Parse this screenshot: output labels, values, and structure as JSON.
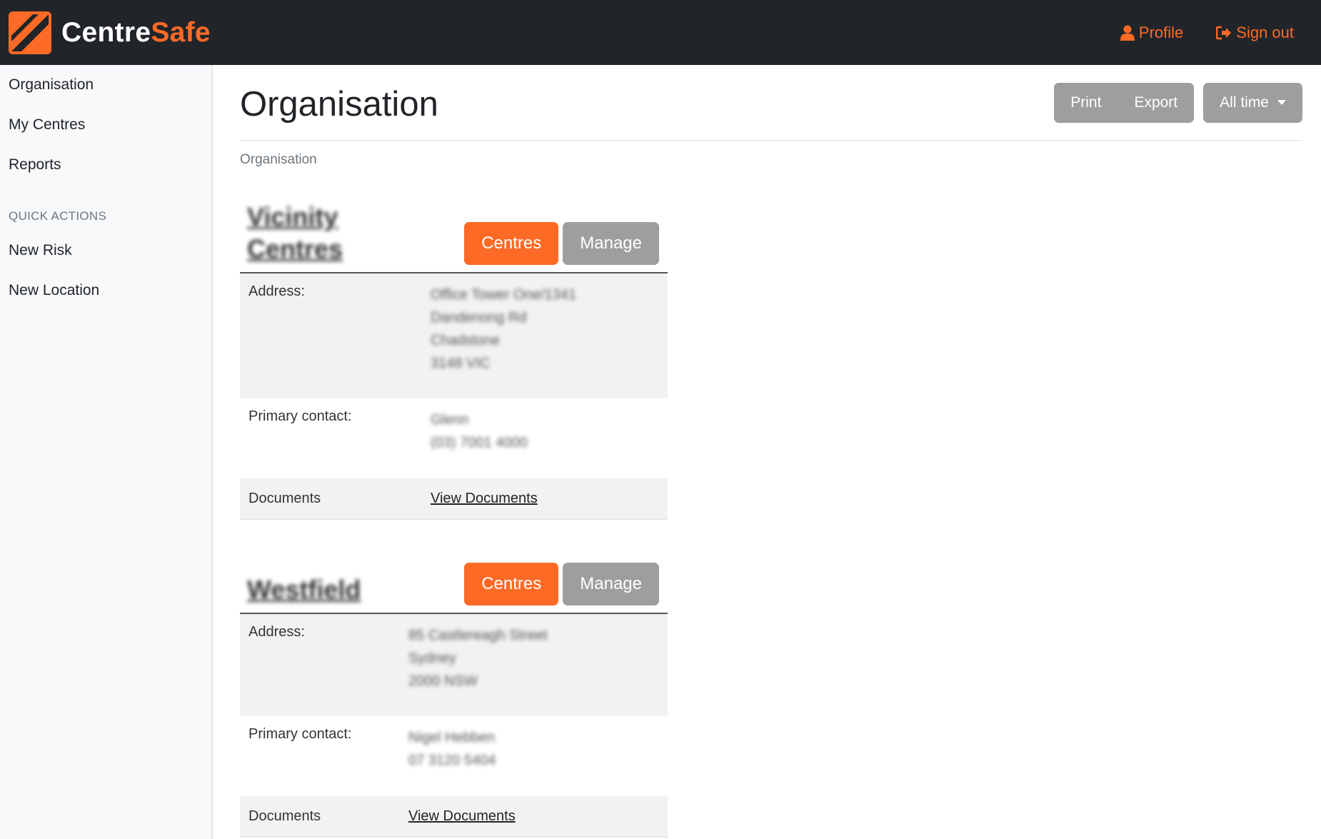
{
  "brand": {
    "name_part1": "Centre",
    "name_part2": "Safe",
    "accent": "#fd6a26",
    "logo_icon": "centresafe-logo-icon"
  },
  "topnav": {
    "profile_label": "Profile",
    "profile_icon": "user-icon",
    "signout_label": "Sign out",
    "signout_icon": "sign-out-icon"
  },
  "sidebar": {
    "items": [
      {
        "label": "Organisation"
      },
      {
        "label": "My Centres"
      },
      {
        "label": "Reports"
      }
    ],
    "quick_actions_heading": "QUICK ACTIONS",
    "quick_actions": [
      {
        "label": "New Risk"
      },
      {
        "label": "New Location"
      }
    ]
  },
  "main": {
    "title": "Organisation",
    "print_label": "Print",
    "export_label": "Export",
    "range_label": "All time",
    "breadcrumb": "Organisation"
  },
  "organisations": [
    {
      "name_line1": "Vicinity",
      "name_line2": "Centres",
      "centres_label": "Centres",
      "manage_label": "Manage",
      "address_label": "Address:",
      "address": [
        "Office Tower One/1341",
        "Dandenong Rd",
        "Chadstone",
        "3148 VIC"
      ],
      "contact_label": "Primary contact:",
      "contact": [
        "Glenn",
        "(03) 7001 4000"
      ],
      "documents_label": "Documents",
      "documents_link": "View Documents"
    },
    {
      "name_line1": "Westfield",
      "centres_label": "Centres",
      "manage_label": "Manage",
      "address_label": "Address:",
      "address": [
        "85 Castlereagh Street",
        "Sydney",
        "2000 NSW"
      ],
      "contact_label": "Primary contact:",
      "contact": [
        "Nigel Hebben",
        "07 3120 5404"
      ],
      "documents_label": "Documents",
      "documents_link": "View Documents"
    }
  ]
}
